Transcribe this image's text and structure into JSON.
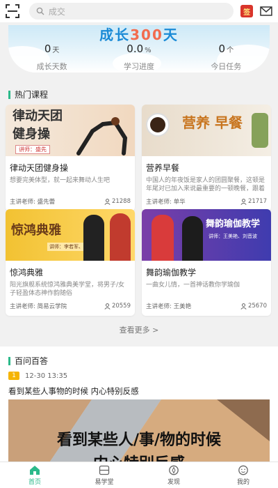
{
  "search": {
    "placeholder": "成交"
  },
  "header_icons": {
    "scan": "scan-icon",
    "sign_badge": "签",
    "mail": "mail-icon"
  },
  "growth": {
    "title_a": "成长",
    "title_num": "300",
    "title_b": "天",
    "stats": [
      {
        "value": "0",
        "unit": "天",
        "label": "成长天数"
      },
      {
        "value": "0.0",
        "unit": "%",
        "label": "学习进度"
      },
      {
        "value": "0",
        "unit": "个",
        "label": "今日任务"
      }
    ]
  },
  "hot": {
    "heading": "热门课程",
    "courses": [
      {
        "img_text": "律动天团\n健身操",
        "img_sub": "讲师：盛先",
        "title": "律动天团健身操",
        "desc": "想要完美体型，就一起来舞动人生吧",
        "teacher": "主讲老师: 盛先蕾",
        "count": "21288"
      },
      {
        "img_text": "营养 早餐",
        "title": "营养早餐",
        "desc": "中国人的年夜饭是家人的团圆聚餐，这顿是年尾对已加入来说最重要的一顿晚餐，跟着老师一起",
        "teacher": "主讲老师: 单华",
        "count": "21717"
      },
      {
        "img_text": "惊鸿典雅",
        "img_sub": "讲师：李若军、姚娜",
        "title": "惊鸿典雅",
        "desc": "阳光旗舰系统惊鸿雅典美学堂，将男子/女子轻盈体态神作韵随俗",
        "teacher": "主讲老师: 简易云学院",
        "count": "20559"
      },
      {
        "img_text": "舞韵瑜伽教学",
        "img_sub": "讲师：王美艳、刘音波",
        "title": "舞韵瑜伽教学",
        "desc": "一曲女儿情，一首神话教你学瑜伽",
        "teacher": "主讲老师: 王美艳",
        "count": "25670"
      }
    ],
    "more": "查看更多 >"
  },
  "qa": {
    "heading": "百问百答",
    "badge": "1",
    "time": "12-30 13:35",
    "title": "看到某些人事物的时候 内心特别反感",
    "banner_text": "看到某些人/事/物的时候",
    "banner_text2": "内心特别反感"
  },
  "nav": {
    "items": [
      {
        "label": "首页",
        "icon": "home-icon"
      },
      {
        "label": "易学堂",
        "icon": "book-icon"
      },
      {
        "label": "发现",
        "icon": "compass-icon"
      },
      {
        "label": "我的",
        "icon": "profile-icon"
      }
    ]
  },
  "colors": {
    "accent": "#2bb98a",
    "title_blue": "#1a8ad6",
    "title_orange": "#f26c4f",
    "badge_yellow": "#f5b400"
  }
}
